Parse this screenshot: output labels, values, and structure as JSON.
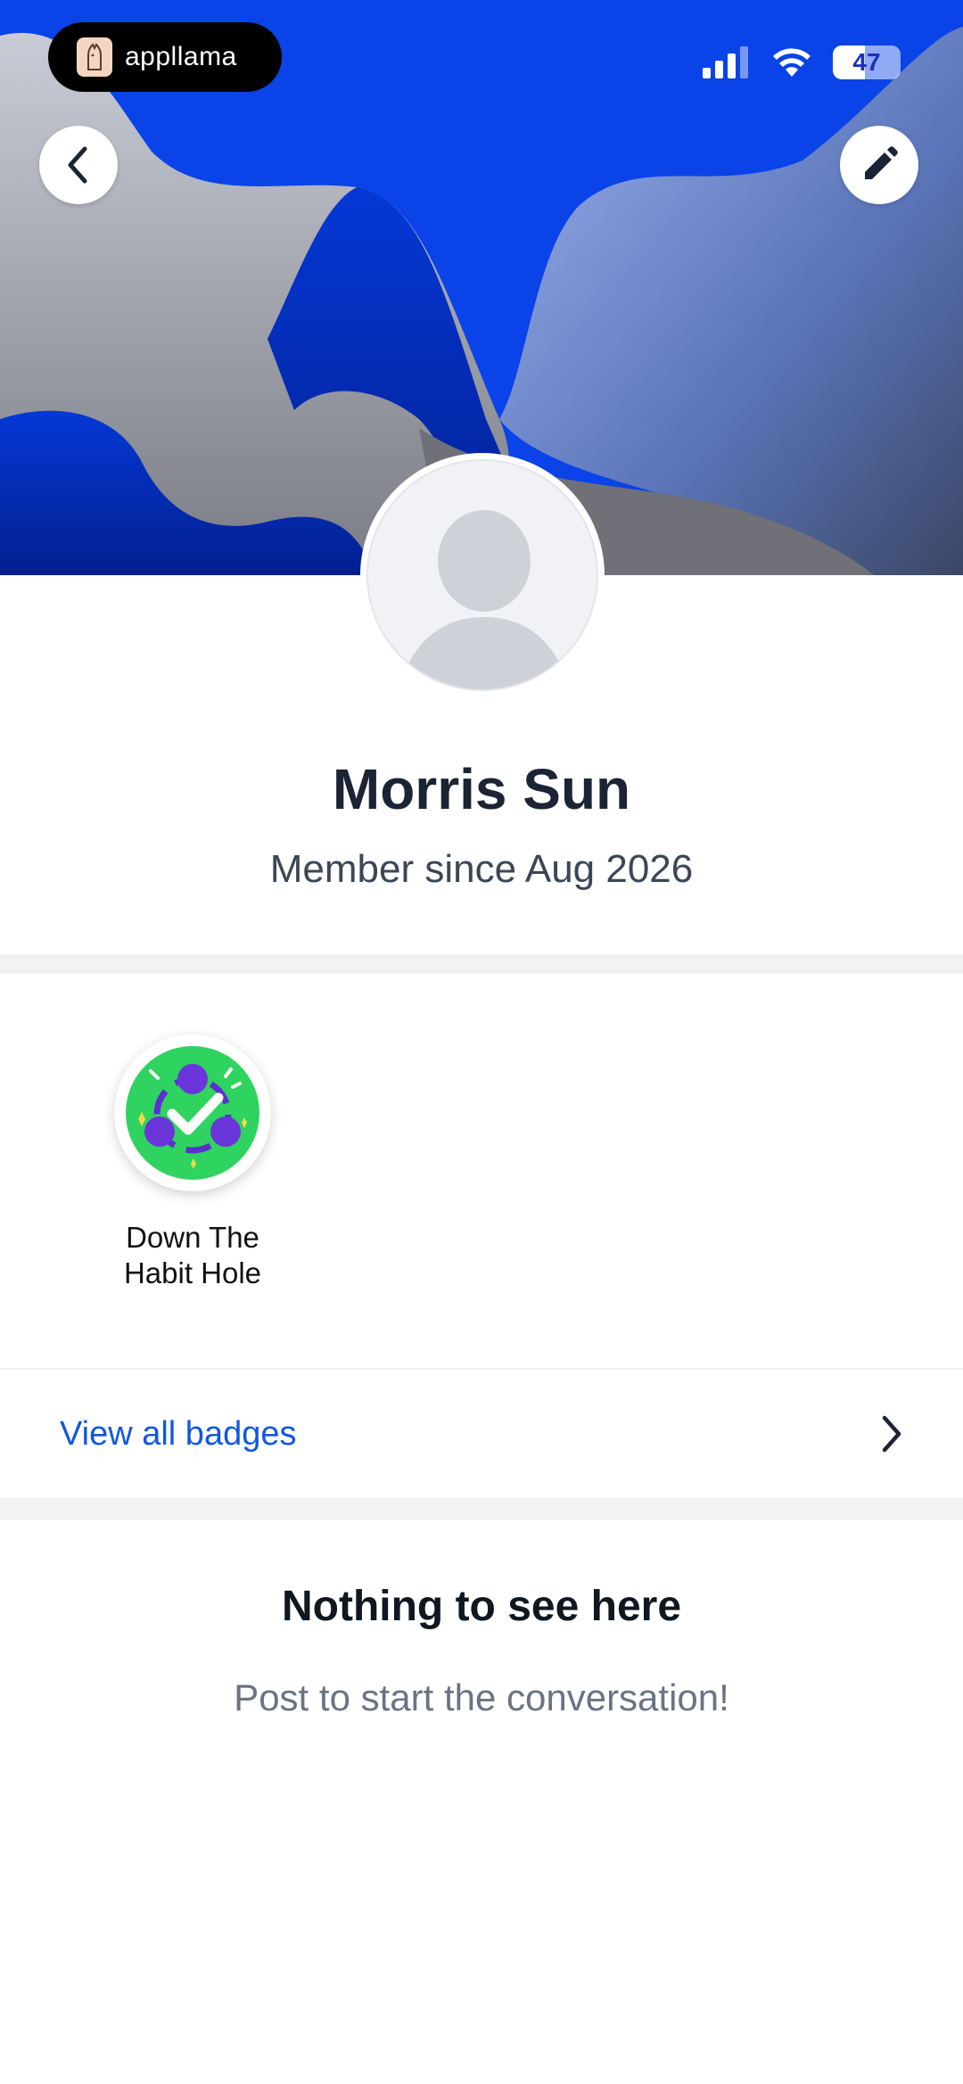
{
  "status_bar": {
    "app_brand": "appllama",
    "battery_level": "47",
    "battery_fraction": 0.47
  },
  "header": {
    "back_icon": "chevron-left-icon",
    "edit_icon": "pencil-icon"
  },
  "profile": {
    "name": "Morris Sun",
    "member_since": "Member since Aug 2026"
  },
  "badges": {
    "items": [
      {
        "label_line1": "Down The",
        "label_line2": "Habit Hole",
        "icon": "habit-check-badge-icon"
      }
    ],
    "view_all_label": "View all badges"
  },
  "empty_state": {
    "title": "Nothing to see here",
    "subtitle": "Post to start the conversation!"
  },
  "colors": {
    "hero_blue": "#0a43e8",
    "link_blue": "#1157e0",
    "badge_green": "#2fd35f",
    "badge_purple": "#6b36d9"
  }
}
